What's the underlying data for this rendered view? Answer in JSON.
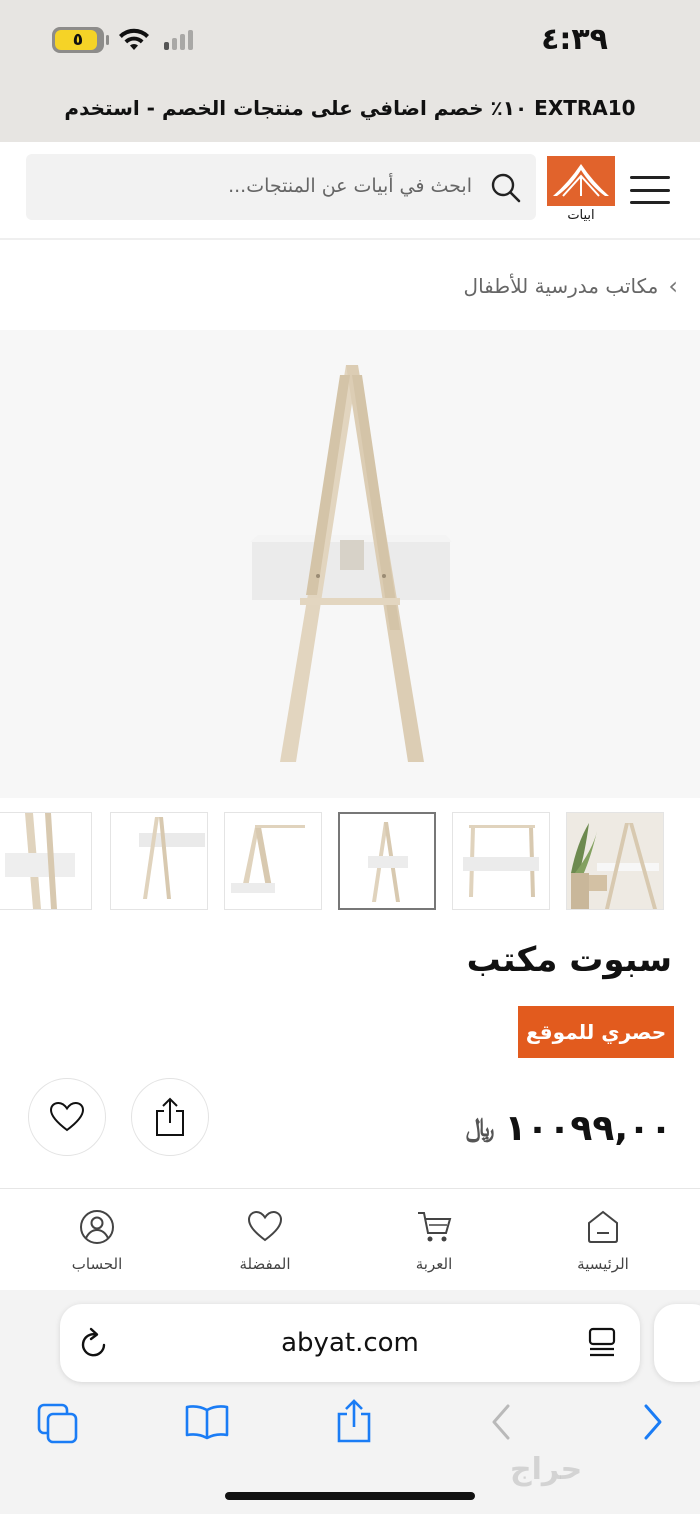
{
  "status_bar": {
    "time": "٤:٣٩",
    "battery_level": "٥"
  },
  "promo": {
    "text": "١٠٪ خصم اضافي على منتجات الخصم - استخدم EXTRA10"
  },
  "header": {
    "logo_text": "ابيات",
    "search_placeholder": "ابحث في أبيات عن المنتجات..."
  },
  "breadcrumb": {
    "label": "مكاتب مدرسية للأطفال"
  },
  "product": {
    "title": "سبوت مكتب",
    "badge": "حصري للموقع",
    "price": "١٠٠٩٩,٠٠",
    "currency_symbol": "﷼",
    "selected_thumbnail": 3
  },
  "bottom_nav": {
    "items": [
      {
        "label": "الرئيسية",
        "icon": "home-icon"
      },
      {
        "label": "العربة",
        "icon": "cart-icon"
      },
      {
        "label": "المفضلة",
        "icon": "heart-icon"
      },
      {
        "label": "الحساب",
        "icon": "account-icon"
      }
    ]
  },
  "browser": {
    "url": "abyat.com"
  },
  "watermark": {
    "text": "حراج"
  },
  "colors": {
    "accent": "#e25b1e",
    "logo": "#e1632c",
    "safari_blue": "#1a7cf5"
  }
}
